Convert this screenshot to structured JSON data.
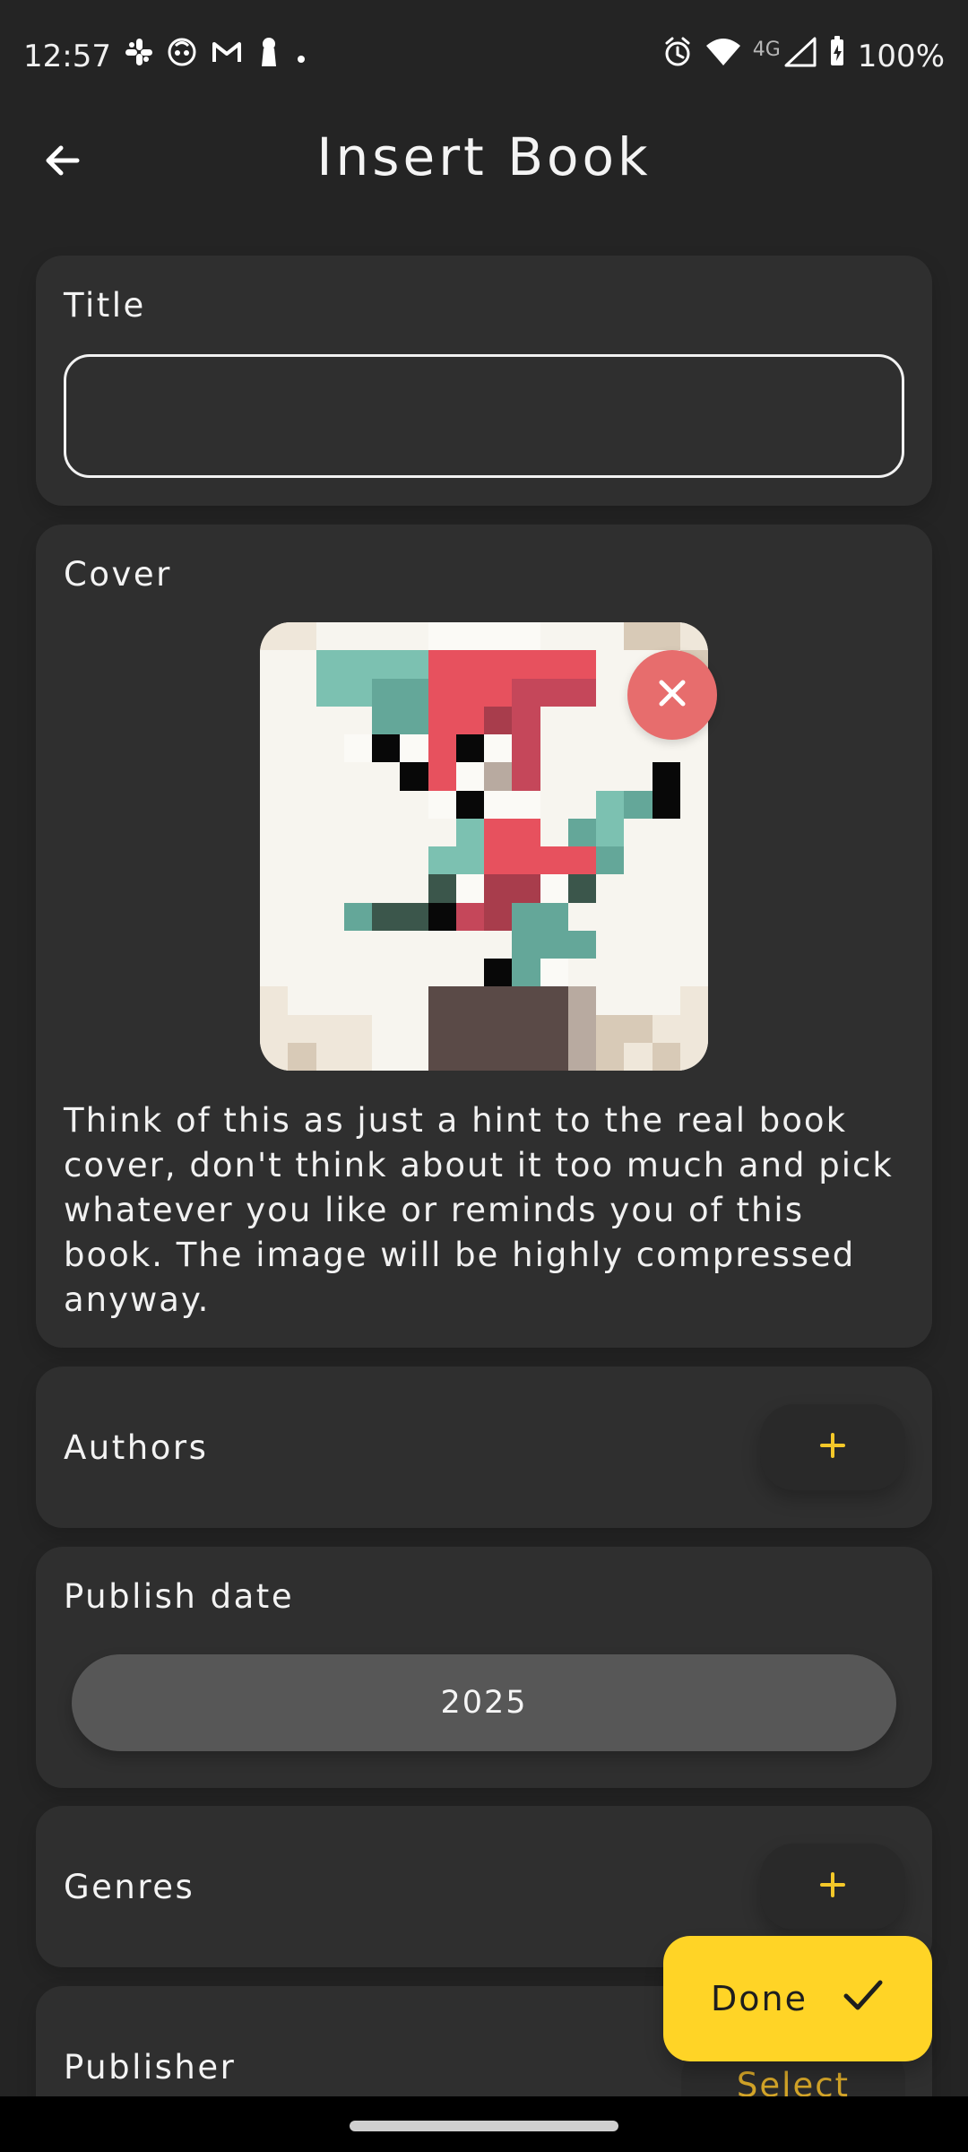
{
  "statusBar": {
    "time": "12:57",
    "networkBadge": "4G",
    "battery": "100%"
  },
  "appBar": {
    "title": "Insert Book"
  },
  "sections": {
    "title": {
      "label": "Title",
      "value": "",
      "placeholder": ""
    },
    "cover": {
      "label": "Cover",
      "hint": "Think of this as just a hint to the real book cover, don't think about it too much and pick whatever you like or reminds you of this book. The image will be highly compressed anyway."
    },
    "authors": {
      "label": "Authors"
    },
    "publishDate": {
      "label": "Publish date",
      "value": "2025"
    },
    "genres": {
      "label": "Genres"
    },
    "publisher": {
      "label": "Publisher",
      "action": "Select"
    }
  },
  "doneButton": {
    "label": "Done"
  },
  "colors": {
    "background": "#242424",
    "card": "#2f2f2f",
    "accent": "#ffd426",
    "coverRemove": "#e76d6d"
  },
  "coverPalette": {
    "W": "#f7f5ef",
    "w": "#fbfaf6",
    "c": "#efe7da",
    "b": "#d8cab7",
    "g": "#7cc1b1",
    "t": "#64a799",
    "d": "#3b564b",
    "r": "#e7515e",
    "m": "#c5475a",
    "n": "#a83d4c",
    "k": "#080808",
    "p": "#5a4a47",
    "s": "#b8aaa0"
  },
  "coverPixels": [
    "ccWWWWwwwwWWWbbc",
    "WWggggrrrrrrWWWb",
    "WWggttrrrmmmWWWW",
    "WWWWttrrnmWWWWWW",
    "WWWwkwrkwmWWWWWW",
    "WWWWWkrwsmWWWWkW",
    "WWWWWWwkwwWWgtkW",
    "WWWWWWWgrrWtgWWW",
    "WWWWWWggrrrrtWWW",
    "WWWWWWdwnnwdWWWW",
    "WWWtddkmnttWWWWW",
    "WWWWWWWWWtttWWWW",
    "WWWWWWWWktwWWWWW",
    "cWWWWWpppppsWWWc",
    "ccccWWpppppsbbcc",
    "cbccWWpppppsbcbc"
  ]
}
